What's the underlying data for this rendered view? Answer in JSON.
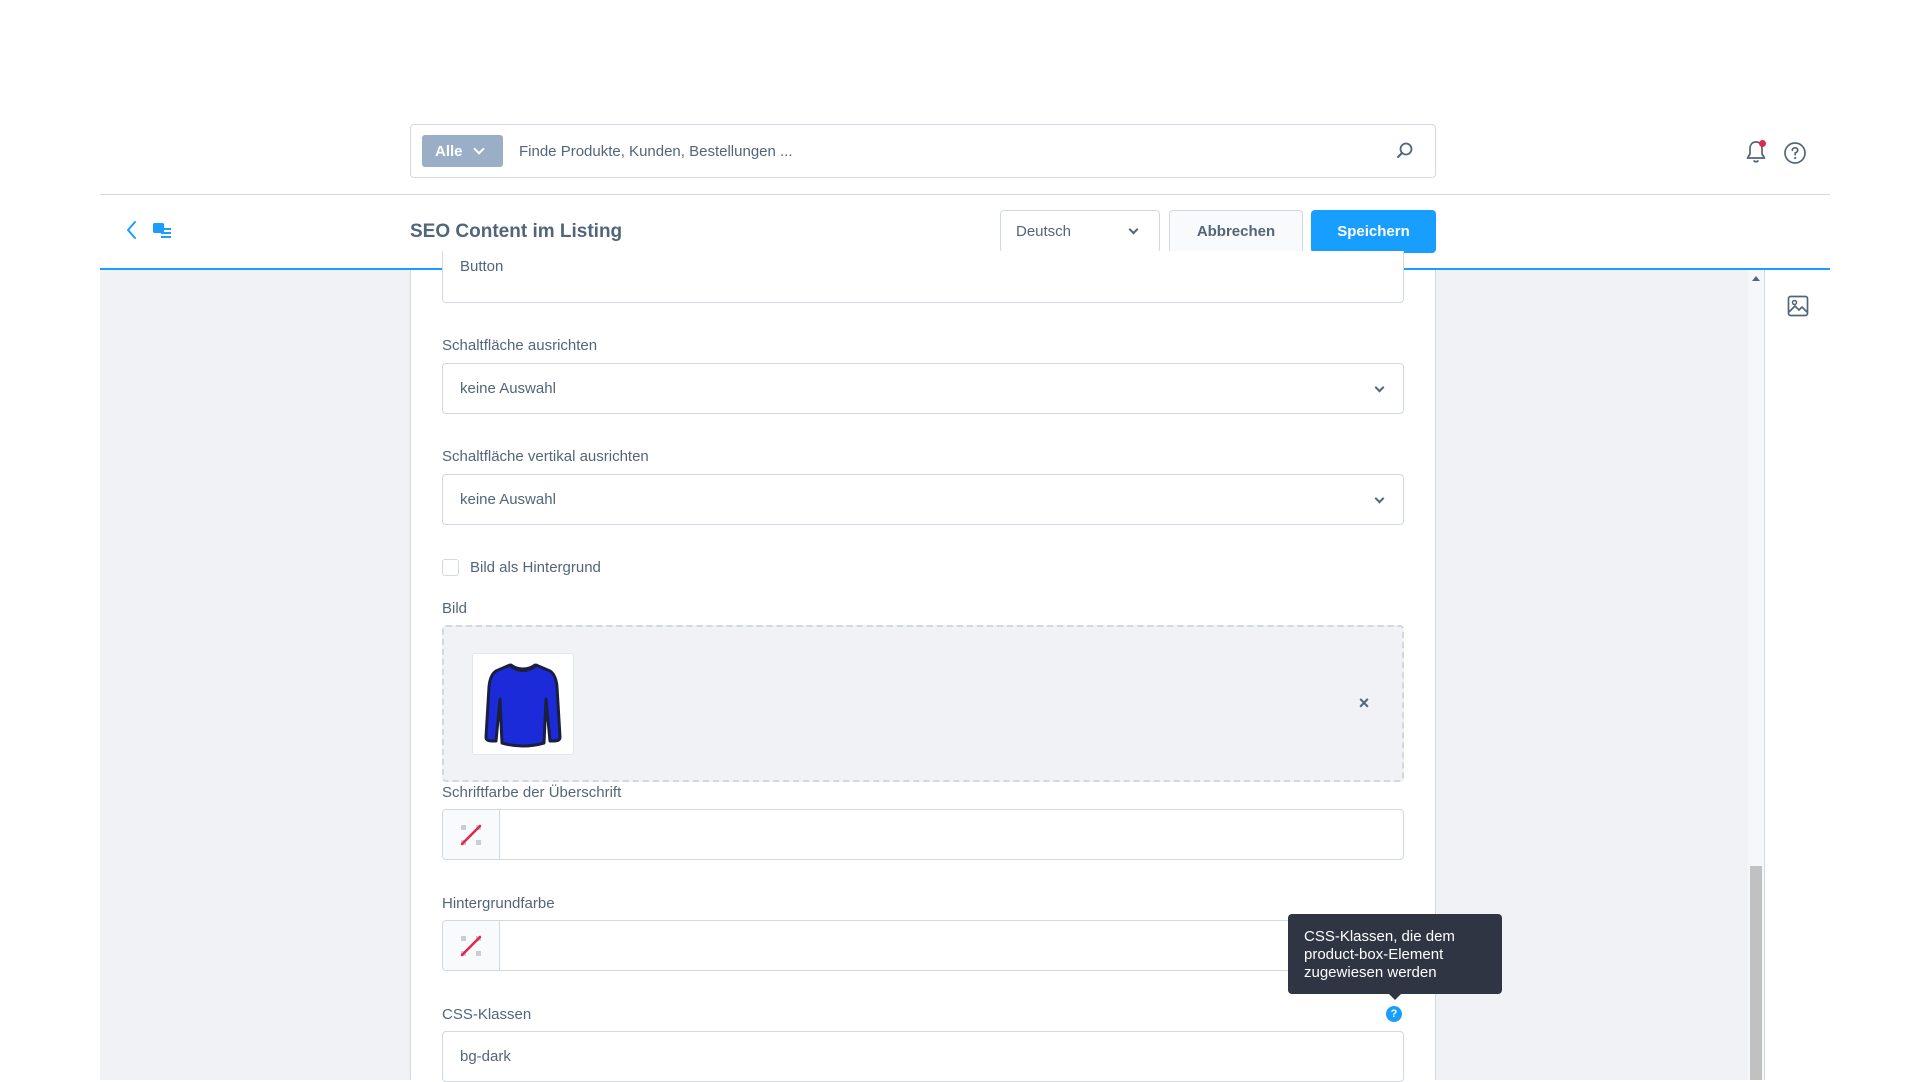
{
  "search": {
    "type_label": "Alle",
    "placeholder": "Finde Produkte, Kunden, Bestellungen ..."
  },
  "smartbar": {
    "title": "SEO Content im Listing",
    "language": "Deutsch",
    "cancel_label": "Abbrechen",
    "save_label": "Speichern"
  },
  "form": {
    "button_text_value": "Button",
    "align_label": "Schaltfläche ausrichten",
    "align_value": "keine Auswahl",
    "valign_label": "Schaltfläche vertikal ausrichten",
    "valign_value": "keine Auswahl",
    "bg_image_checkbox_label": "Bild als Hintergrund",
    "image_label": "Bild",
    "remove_symbol": "×",
    "heading_color_label": "Schriftfarbe der Überschrift",
    "bg_color_label": "Hintergrundfarbe",
    "css_label": "CSS-Klassen",
    "css_value": "bg-dark",
    "css_help_symbol": "?",
    "css_tooltip": "CSS-Klassen, die dem product-box-Element zugewiesen werden"
  },
  "colors": {
    "primary": "#189eff",
    "text": "#52667a",
    "border": "#d1d9e0",
    "panel_bg": "#f0f2f5",
    "notification_dot": "#de294c",
    "tooltip_bg": "#2f3542"
  },
  "icons": {
    "search": "search-icon",
    "bell": "bell-icon",
    "help": "help-circle-icon",
    "back": "chevron-left-icon",
    "module": "content-module-icon",
    "image_sidebar": "image-icon",
    "product": "sweater-image",
    "no_color": "no-color-icon"
  }
}
